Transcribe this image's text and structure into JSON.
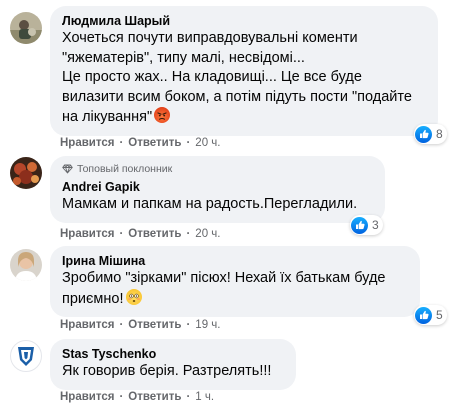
{
  "comments": [
    {
      "author": "Людмила Шарый",
      "lines": [
        "Хочеться почути виправдовувальні коменти",
        "\"яжематерів\", типу малі, несвідомі...",
        "Це просто жах.. На кладовищі... Це все буде",
        "вилазити всим боком, а потім підуть пости \"подайте",
        "на лікування\""
      ],
      "emoji": "angry-face-emoji",
      "like": "Нравится",
      "reply": "Ответить",
      "time": "20 ч.",
      "reaction_count": "8"
    },
    {
      "author": "Andrei Gapik",
      "badge": "Топовый поклонник",
      "lines": [
        "Мамкам и папкам на радость.Перегладили."
      ],
      "like": "Нравится",
      "reply": "Ответить",
      "time": "20 ч.",
      "reaction_count": "3"
    },
    {
      "author": "Ірина Мішина",
      "lines": [
        "Зробимо \"зірками\" пісюх! Нехай їх батькам буде",
        "приємно!"
      ],
      "emoji": "flushed-face-emoji",
      "like": "Нравится",
      "reply": "Ответить",
      "time": "19 ч.",
      "reaction_count": "5"
    },
    {
      "author": "Stas Tyschenko",
      "lines": [
        "Як говорив берія. Разтрелять!!!"
      ],
      "like": "Нравится",
      "reply": "Ответить",
      "time": "1 ч."
    }
  ],
  "colors": {
    "bubble_bg": "#f0f2f5",
    "meta_text": "#65676b",
    "like_blue": "#1877f2"
  }
}
